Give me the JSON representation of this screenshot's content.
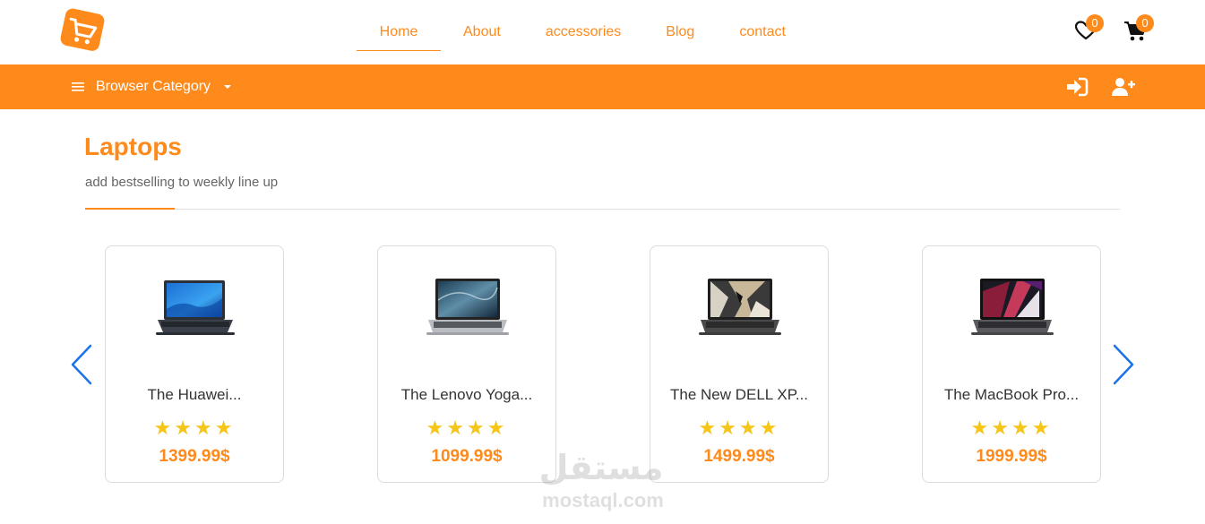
{
  "header": {
    "nav": [
      {
        "label": "Home",
        "active": true
      },
      {
        "label": "About",
        "active": false
      },
      {
        "label": "accessories",
        "active": false
      },
      {
        "label": "Blog",
        "active": false
      },
      {
        "label": "contact",
        "active": false
      }
    ],
    "wishlist_count": "0",
    "cart_count": "0",
    "icons": {
      "logo": "shopping-cart-logo",
      "wishlist": "heart-icon",
      "cart": "cart-icon"
    }
  },
  "category_bar": {
    "browse_label": "Browser Category",
    "icons": {
      "menu": "bars-icon",
      "caret": "caret-down-icon",
      "login": "sign-in-icon",
      "register": "user-plus-icon"
    }
  },
  "section": {
    "title": "Laptops",
    "subtitle": "add bestselling to weekly line up"
  },
  "products": [
    {
      "name": "The Huawei...",
      "price": "1399.99$",
      "stars": "★★★★",
      "rating": 4
    },
    {
      "name": "The Lenovo Yoga...",
      "price": "1099.99$",
      "stars": "★★★★",
      "rating": 4
    },
    {
      "name": "The New DELL XP...",
      "price": "1499.99$",
      "stars": "★★★★",
      "rating": 4
    },
    {
      "name": "The MacBook Pro...",
      "price": "1999.99$",
      "stars": "★★★★",
      "rating": 4
    }
  ],
  "watermark": {
    "arabic": "مستقل",
    "latin": "mostaql.com"
  },
  "colors": {
    "accent": "#ff8a1c",
    "star": "#f5c518",
    "arrow": "#1a73e8"
  }
}
